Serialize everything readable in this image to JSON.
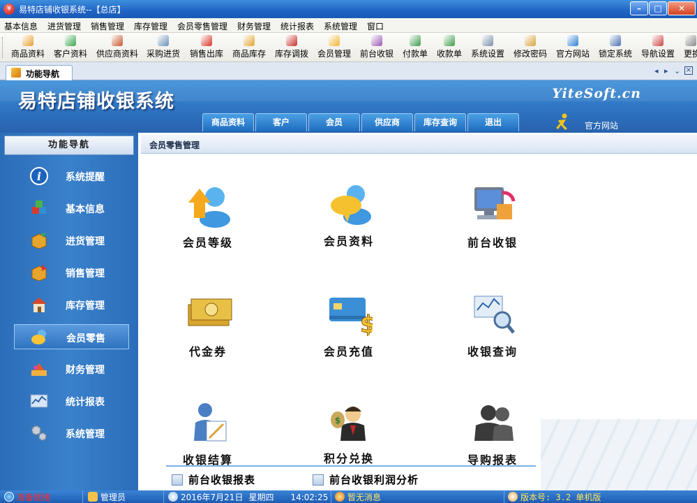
{
  "window": {
    "title": "易特店铺收银系统--【总店】"
  },
  "menu": [
    "基本信息",
    "进货管理",
    "销售管理",
    "库存管理",
    "会员零售管理",
    "财务管理",
    "统计报表",
    "系统管理",
    "窗口"
  ],
  "toolbar": [
    {
      "label": "商品资料",
      "icon": "goods-icon",
      "color": "#e8a030"
    },
    {
      "label": "客户资料",
      "icon": "customer-icon",
      "color": "#3aa64c"
    },
    {
      "label": "供应商资料",
      "icon": "supplier-icon",
      "color": "#c9552b"
    },
    {
      "label": "采购进货",
      "icon": "purchase-icon",
      "color": "#6b8fb8"
    },
    {
      "label": "销售出库",
      "icon": "sales-out-icon",
      "color": "#d8332a"
    },
    {
      "label": "商品库存",
      "icon": "inventory-icon",
      "color": "#e2a52e"
    },
    {
      "label": "库存调拨",
      "icon": "transfer-icon",
      "color": "#c8302a"
    },
    {
      "label": "会员管理",
      "icon": "member-icon",
      "color": "#f0b531"
    },
    {
      "label": "前台收银",
      "icon": "cashier-icon",
      "color": "#9b59b6"
    },
    {
      "label": "付款单",
      "icon": "payment-icon",
      "color": "#3d9c4a"
    },
    {
      "label": "收款单",
      "icon": "receipt-icon",
      "color": "#3d9c4a"
    },
    {
      "label": "系统设置",
      "icon": "settings-icon",
      "color": "#7a8fa8"
    },
    {
      "label": "修改密码",
      "icon": "password-icon",
      "color": "#d9a23a"
    },
    {
      "label": "官方网站",
      "icon": "ie-icon",
      "color": "#2d7dd2"
    },
    {
      "label": "锁定系统",
      "icon": "lock-icon",
      "color": "#4b6fb0"
    },
    {
      "label": "导航设置",
      "icon": "nav-settings-icon",
      "color": "#c44"
    },
    {
      "label": "更换",
      "icon": "switch-icon",
      "color": "#888"
    }
  ],
  "tabs": {
    "active": "功能导航"
  },
  "banner": {
    "title": "易特店铺收银系统",
    "brand": "YiteSoft.cn",
    "tabs": [
      "商品资料",
      "客户",
      "会员",
      "供应商",
      "库存查询",
      "退出"
    ],
    "site_link": "官方网站"
  },
  "sidebar": {
    "header": "功能导航",
    "items": [
      {
        "label": "系统提醒",
        "icon": "info-icon",
        "color": "#2d6fc6"
      },
      {
        "label": "基本信息",
        "icon": "cubes-icon",
        "color": "#3fa54a"
      },
      {
        "label": "进货管理",
        "icon": "box-in-icon",
        "color": "#e3a22d"
      },
      {
        "label": "销售管理",
        "icon": "box-out-icon",
        "color": "#e3a22d"
      },
      {
        "label": "库存管理",
        "icon": "warehouse-icon",
        "color": "#d8532c"
      },
      {
        "label": "会员零售",
        "icon": "member-chat-icon",
        "color": "#f2b933"
      },
      {
        "label": "财务管理",
        "icon": "finance-icon",
        "color": "#e07a2a"
      },
      {
        "label": "统计报表",
        "icon": "chart-icon",
        "color": "#5c8fc9"
      },
      {
        "label": "系统管理",
        "icon": "gears-icon",
        "color": "#a7b3c2"
      }
    ],
    "active_index": 5
  },
  "main": {
    "header": "会员零售管理",
    "tiles": [
      {
        "label": "会员等级",
        "icon": "member-level-icon",
        "color": "#f4a81c"
      },
      {
        "label": "会员资料",
        "icon": "member-info-icon",
        "color": "#f2c12e"
      },
      {
        "label": "前台收银",
        "icon": "pos-icon",
        "color": "#7d6fd1"
      },
      {
        "label": "代金券",
        "icon": "voucher-icon",
        "color": "#d9a52e"
      },
      {
        "label": "会员充值",
        "icon": "recharge-icon",
        "color": "#3b8fd6"
      },
      {
        "label": "收银查询",
        "icon": "query-icon",
        "color": "#6aa0d8"
      },
      {
        "label": "收银结算",
        "icon": "settlement-icon",
        "color": "#4a7fc4"
      },
      {
        "label": "积分兑换",
        "icon": "points-exchange-icon",
        "color": "#d6a42a"
      },
      {
        "label": "导购报表",
        "icon": "guide-report-icon",
        "color": "#3a3a3a"
      }
    ],
    "reports": [
      {
        "label": "前台收银报表",
        "icon": "report-icon"
      },
      {
        "label": "前台收银利润分析",
        "icon": "report-icon"
      }
    ]
  },
  "status": {
    "ready": "准备就绪",
    "user": "管理员",
    "date": "2016年7月21日",
    "weekday": "星期四",
    "time": "14:02:25",
    "message": "暂无消息",
    "version": "版本号: 3.2 单机版"
  },
  "colors": {
    "accent": "#2e74c2",
    "status_alert": "#ff2a2a",
    "status_msg": "#ffe45a"
  }
}
